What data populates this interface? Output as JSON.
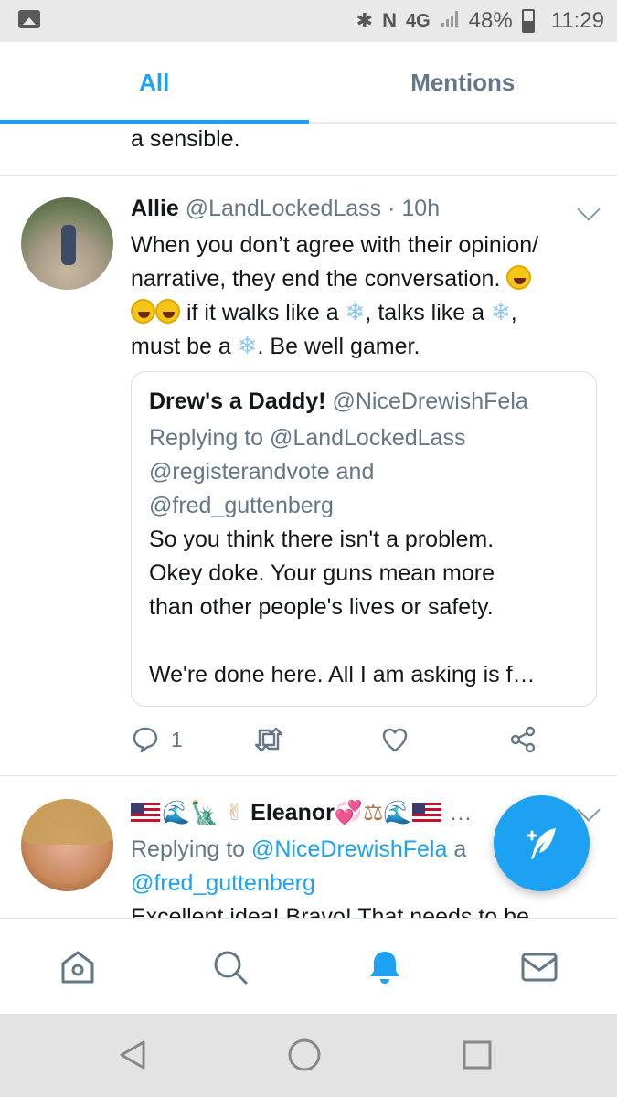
{
  "status_bar": {
    "network": "4G",
    "battery": "48%",
    "time": "11:29"
  },
  "tabs": [
    {
      "label": "All",
      "active": true
    },
    {
      "label": "Mentions",
      "active": false
    }
  ],
  "feed": {
    "previous_tail": "a  sensible.",
    "tweet1": {
      "name": "Allie",
      "handle": "@LandLockedLass",
      "dot": "·",
      "time": "10h",
      "line1": "When you don’t agree with their opinion/",
      "line2a": "narrative, they end the conversation.",
      "line3a": "if it walks like a",
      "line3b": ", talks like a",
      "line3c": ",",
      "line4a": "must be a",
      "line4b": ". Be well gamer.",
      "quote": {
        "name": "Drew's a Daddy!",
        "handle": "@NiceDrewishFela",
        "replying_prefix": "Replying to",
        "replying_line1": "@LandLockedLass",
        "replying_line2": "@registerandvote and",
        "replying_line3": "@fred_guttenberg",
        "text_line1": "So you think there isn't a problem.",
        "text_line2": "Okey doke. Your guns mean more",
        "text_line3": "than other people's lives or safety.",
        "text_line4": "We're done here. All I am asking is f…"
      },
      "reply_count": "1"
    },
    "tweet2": {
      "name": "Eleanor",
      "ellipsis": "…",
      "replying_prefix": "Replying to",
      "replying_handle1": "@NiceDrewishFela",
      "replying_and": "a",
      "replying_handle2": "@fred_guttenberg",
      "text_cut": "Excellent idea! Bravo! That needs to be"
    }
  },
  "colors": {
    "accent": "#1da1f2",
    "secondary_text": "#657786",
    "divider": "#e1e8ed"
  },
  "icons": {
    "reply": "reply-icon",
    "retweet": "retweet-icon",
    "like": "heart-icon",
    "share": "share-icon",
    "compose": "compose-tweet-icon",
    "home": "home-icon",
    "search": "search-icon",
    "notifications": "bell-icon",
    "messages": "mail-icon"
  }
}
